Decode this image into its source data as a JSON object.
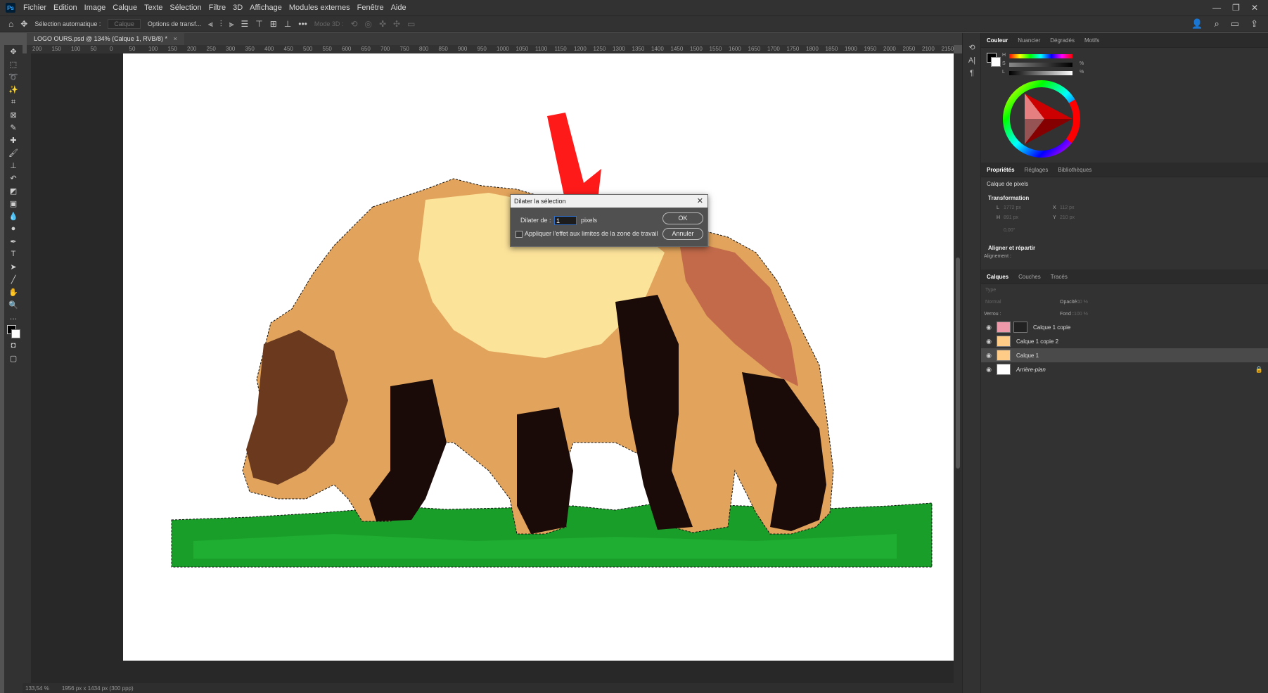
{
  "menu": {
    "items": [
      "Fichier",
      "Edition",
      "Image",
      "Calque",
      "Texte",
      "Sélection",
      "Filtre",
      "3D",
      "Affichage",
      "Modules externes",
      "Fenêtre",
      "Aide"
    ]
  },
  "options": {
    "auto_select": "Sélection automatique :",
    "auto_select_value": "Calque",
    "transform_options": "Options de transf...",
    "mode_3d": "Mode 3D :"
  },
  "document": {
    "tab_title": "LOGO OURS.psd @ 134% (Calque 1, RVB/8) *",
    "close": "×"
  },
  "rulers": {
    "h_ticks": [
      "200",
      "150",
      "100",
      "50",
      "0",
      "50",
      "100",
      "150",
      "200",
      "250",
      "300",
      "350",
      "400",
      "450",
      "500",
      "550",
      "600",
      "650",
      "700",
      "750",
      "800",
      "850",
      "900",
      "950",
      "1000",
      "1050",
      "1100",
      "1150",
      "1200",
      "1250",
      "1300",
      "1350",
      "1400",
      "1450",
      "1500",
      "1550",
      "1600",
      "1650",
      "1700",
      "1750",
      "1800",
      "1850",
      "1900",
      "1950",
      "2000",
      "2050",
      "2100",
      "2150"
    ]
  },
  "status": {
    "zoom": "133,54 %",
    "doc_size": "1956 px x 1434 px (300 ppp)"
  },
  "dialog": {
    "title": "Dilater la sélection",
    "expand_label": "Dilater de :",
    "expand_value": "1",
    "unit": "pixels",
    "apply_canvas": "Appliquer l'effet aux limites de la zone de travail",
    "ok": "OK",
    "cancel": "Annuler"
  },
  "color_panel": {
    "tabs": [
      "Couleur",
      "Nuancier",
      "Dégradés",
      "Motifs"
    ],
    "h": "H",
    "s": "S",
    "l": "L",
    "pct": "%"
  },
  "properties_panel": {
    "tabs": [
      "Propriétés",
      "Réglages",
      "Bibliothèques"
    ],
    "layer_kind": "Calque de pixels",
    "transform": "Transformation",
    "w_label": "L",
    "w_value": "1772 px",
    "h_label": "H",
    "h_value": "891 px",
    "x_label": "X",
    "x_value": "112 px",
    "y_label": "Y",
    "y_value": "210 px",
    "angle_value": "0,00°",
    "align": "Aligner et répartir",
    "alignment": "Alignement :"
  },
  "layers_panel": {
    "tabs": [
      "Calques",
      "Couches",
      "Tracés"
    ],
    "search": "Type",
    "blend": "Normal",
    "opacity_label": "Opacité :",
    "opacity_value": "100 %",
    "lock_label": "Verrou :",
    "fill_label": "Fond :",
    "fill_value": "100 %",
    "layers": [
      {
        "name": "Calque 1 copie",
        "mask": true
      },
      {
        "name": "Calque 1 copie 2",
        "mask": false
      },
      {
        "name": "Calque 1",
        "mask": false,
        "selected": true
      },
      {
        "name": "Arrière-plan",
        "mask": false,
        "locked": true
      }
    ]
  },
  "colors": {
    "arrow": "#ff1a1a",
    "grass": "#1a9e2a",
    "selection_blue": "#2f6ec9"
  }
}
